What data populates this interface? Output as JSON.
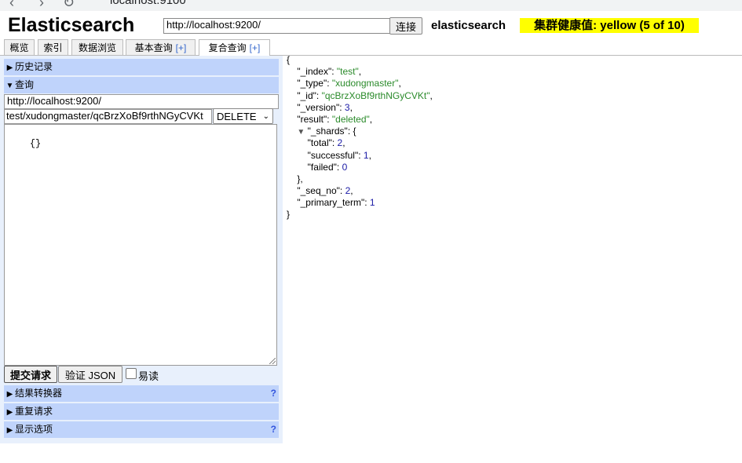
{
  "browser": {
    "url": "localhost:9100"
  },
  "header": {
    "title": "Elasticsearch",
    "connection_url": "http://localhost:9200/",
    "connect_label": "连接",
    "cluster_name": "elasticsearch",
    "health": "集群健康值: yellow (5 of 10)",
    "health_color": "#ffff00"
  },
  "tabs": [
    {
      "label": "概览"
    },
    {
      "label": "索引"
    },
    {
      "label": "数据浏览"
    },
    {
      "label": "基本查询",
      "plus": "[+]"
    },
    {
      "label": "复合查询",
      "plus": "[+]",
      "active": true
    }
  ],
  "query_panel": {
    "history_label": "历史记录",
    "query_label": "查询",
    "base_url": "http://localhost:9200/",
    "path": "test/xudongmaster/qcBrzXoBf9rthNGyCVKt",
    "method": "DELETE",
    "body": "{}",
    "submit_label": "提交请求",
    "validate_label": "验证 JSON",
    "pretty_label": "易读",
    "transformer_label": "结果转换器",
    "repeat_label": "重复请求",
    "display_label": "显示选项",
    "help_mark": "?"
  },
  "response": {
    "_index": "test",
    "_type": "xudongmaster",
    "_id": "qcBrzXoBf9rthNGyCVKt",
    "_version": "3",
    "result": "deleted",
    "_shards": {
      "total": "2",
      "successful": "1",
      "failed": "0"
    },
    "_seq_no": "2",
    "_primary_term": "1"
  }
}
